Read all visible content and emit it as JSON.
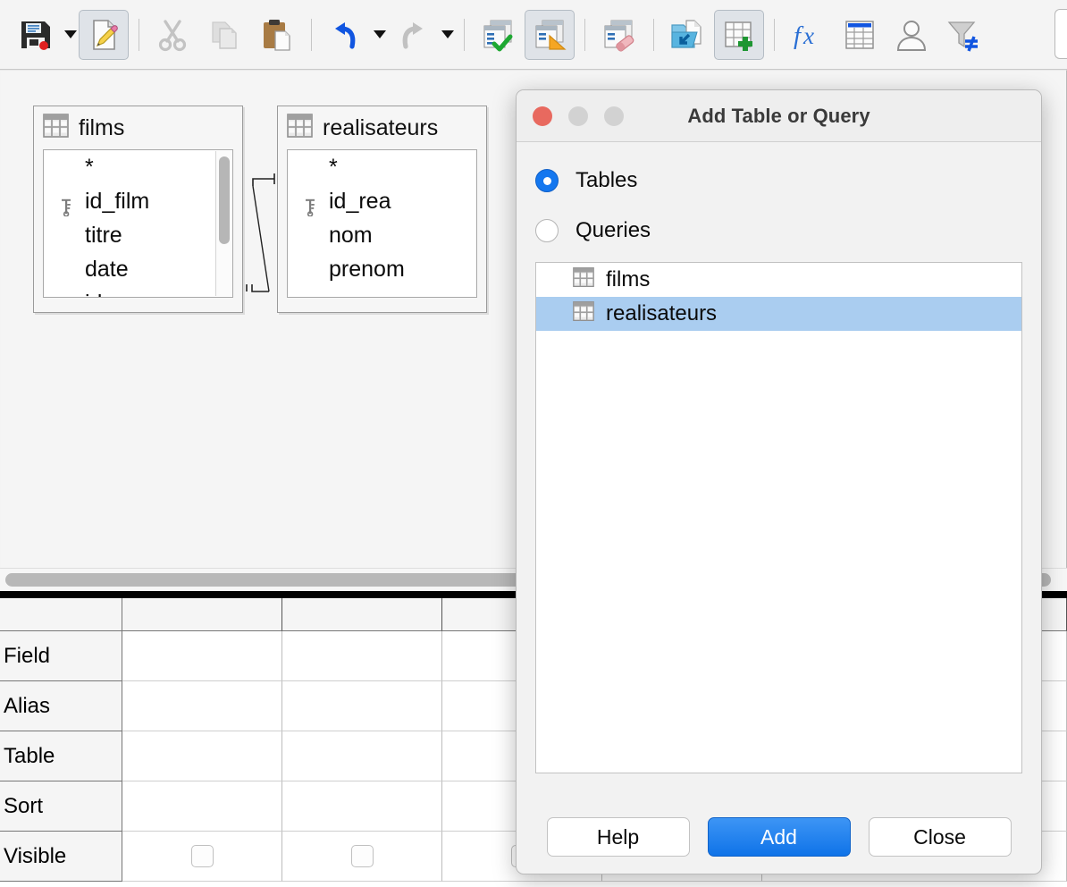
{
  "app": {
    "toolbar": {
      "buttons": [
        {
          "name": "save-button",
          "icon": "floppy-disk-icon",
          "active": false,
          "dropdown": true
        },
        {
          "name": "edit-document-button",
          "icon": "document-pencil-icon",
          "active": true,
          "dropdown": false
        },
        {
          "name": "cut-button",
          "icon": "scissors-icon",
          "active": false,
          "dropdown": false
        },
        {
          "name": "copy-button",
          "icon": "copy-pages-icon",
          "active": false,
          "dropdown": false
        },
        {
          "name": "paste-button",
          "icon": "clipboard-icon",
          "active": false,
          "dropdown": false
        },
        {
          "name": "undo-button",
          "icon": "undo-arrow-icon",
          "active": false,
          "dropdown": true
        },
        {
          "name": "redo-button",
          "icon": "redo-arrow-icon",
          "active": false,
          "dropdown": true
        },
        {
          "name": "run-query-button",
          "icon": "table-checkmark-icon",
          "active": false,
          "dropdown": false
        },
        {
          "name": "design-view-button",
          "icon": "table-ruler-icon",
          "active": true,
          "dropdown": false
        },
        {
          "name": "clear-query-button",
          "icon": "table-eraser-icon",
          "active": false,
          "dropdown": false
        },
        {
          "name": "switch-design-sql-button",
          "icon": "folder-import-icon",
          "active": false,
          "dropdown": false
        },
        {
          "name": "add-table-button",
          "icon": "table-plus-icon",
          "active": true,
          "dropdown": false
        },
        {
          "name": "functions-button",
          "icon": "fx-icon",
          "active": false,
          "dropdown": false
        },
        {
          "name": "table-names-button",
          "icon": "table-header-icon",
          "active": false,
          "dropdown": false
        },
        {
          "name": "distinct-values-button",
          "icon": "person-icon",
          "active": false,
          "dropdown": false
        },
        {
          "name": "filter-not-equal-button",
          "icon": "funnel-not-equal-icon",
          "active": false,
          "dropdown": false
        }
      ]
    },
    "design_area": {
      "tables": [
        {
          "name": "films",
          "icon": "table-icon",
          "fields": [
            {
              "label": "*",
              "key": false
            },
            {
              "label": "id_film",
              "key": true
            },
            {
              "label": "titre",
              "key": false
            },
            {
              "label": "date",
              "key": false
            },
            {
              "label": "id_rea",
              "key": false
            }
          ],
          "scrollbar": "vertical-scrollbar"
        },
        {
          "name": "realisateurs",
          "icon": "table-icon",
          "fields": [
            {
              "label": "*",
              "key": false
            },
            {
              "label": "id_rea",
              "key": true
            },
            {
              "label": "nom",
              "key": false
            },
            {
              "label": "prenom",
              "key": false
            }
          ],
          "scrollbar": null
        }
      ],
      "relation": {
        "from": "films.id_rea",
        "to": "realisateurs.id_rea"
      }
    },
    "query_grid": {
      "row_labels": [
        "",
        "Field",
        "Alias",
        "Table",
        "Sort",
        "Visible"
      ],
      "column_count": 6,
      "visible_checkboxes": [
        false,
        false,
        false,
        false,
        false,
        false
      ]
    }
  },
  "dialog": {
    "title": "Add Table or Query",
    "window_controls": [
      "close-button",
      "minimize-button",
      "maximize-button"
    ],
    "radio_options": [
      {
        "label": "Tables",
        "selected": true
      },
      {
        "label": "Queries",
        "selected": false
      }
    ],
    "list": [
      {
        "label": "films",
        "icon": "table-icon",
        "selected": false
      },
      {
        "label": "realisateurs",
        "icon": "table-icon",
        "selected": true
      }
    ],
    "buttons": {
      "help": "Help",
      "add": "Add",
      "close": "Close"
    }
  },
  "colors": {
    "accent_blue": "#1477ef",
    "selection_blue": "#aacdf0",
    "toolbar_bg": "#f4f4f4",
    "close_red": "#e8695f"
  }
}
